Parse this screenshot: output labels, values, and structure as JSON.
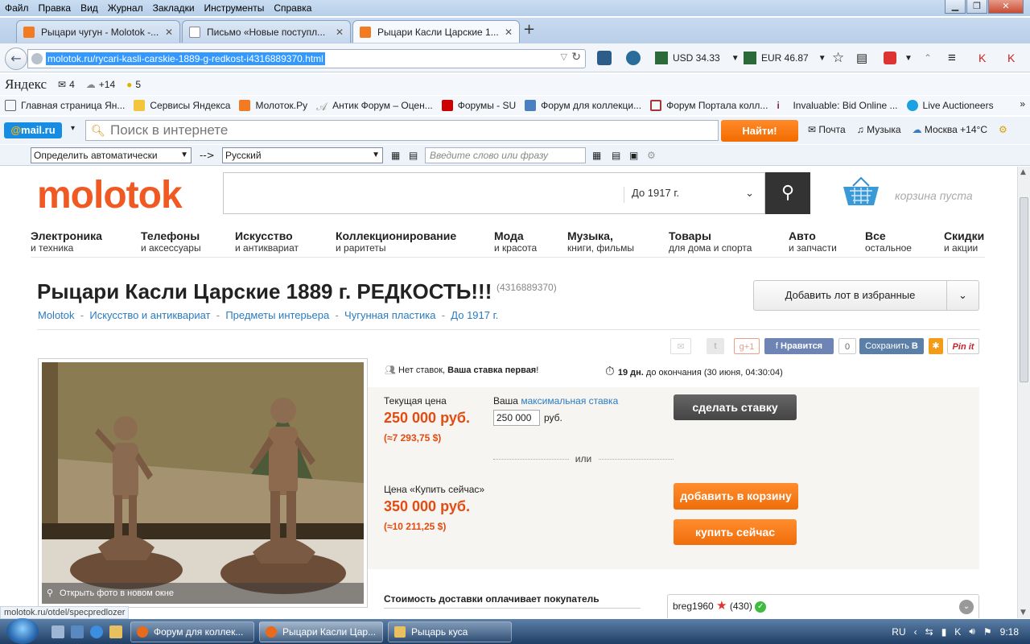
{
  "menu": [
    "Файл",
    "Правка",
    "Вид",
    "Журнал",
    "Закладки",
    "Инструменты",
    "Справка"
  ],
  "tabs": [
    {
      "label": "Рыцари чугун - Molotok -...",
      "icon": "molotok-favicon"
    },
    {
      "label": "Письмо «Новые поступл...",
      "icon": "mail-favicon"
    },
    {
      "label": "Рыцари Касли Царские 1...",
      "icon": "molotok-favicon",
      "active": true
    }
  ],
  "url": "molotok.ru/rycari-kasli-carskie-1889-g-redkost-i4316889370.html",
  "currency": {
    "usd": "USD 34.33",
    "eur": "EUR 46.87"
  },
  "yandex": {
    "logo": "Яндекс",
    "mail_count": "4",
    "weather": "+14",
    "lenta": "5"
  },
  "bookmarks": [
    "Главная страница Ян...",
    "Сервисы Яндекса",
    "Молоток.Ру",
    "Антик Форум – Оцен...",
    "Форумы - SU",
    "Форум для коллекци...",
    "Форум Портала колл...",
    "Invaluable: Bid Online ...",
    "Live Auctioneers"
  ],
  "mailru": {
    "logo_prefix": "@",
    "logo_text": "mail.ru",
    "search_placeholder": "Поиск в интернете",
    "find_button": "Найти!",
    "mail": "Почта",
    "music": "Музыка",
    "weather": "Москва +14°C"
  },
  "translator": {
    "from": "Определить автоматически",
    "arrow": "-->",
    "to": "Русский",
    "placeholder": "Введите слово или фразу"
  },
  "site": {
    "logo": "molotok",
    "search_category": "До 1917 г.",
    "cart": "корзина пуста",
    "nav": [
      {
        "title": "Электроника",
        "sub": "и техника"
      },
      {
        "title": "Телефоны",
        "sub": "и аксессуары"
      },
      {
        "title": "Искусство",
        "sub": "и антиквариат"
      },
      {
        "title": "Коллекционирование",
        "sub": "и раритеты"
      },
      {
        "title": "Мода",
        "sub": "и красота"
      },
      {
        "title": "Музыка,",
        "sub": "книги, фильмы"
      },
      {
        "title": "Товары",
        "sub": "для дома и спорта"
      },
      {
        "title": "Авто",
        "sub": "и запчасти"
      },
      {
        "title": "Все",
        "sub": "остальное"
      },
      {
        "title": "Скидки",
        "sub": "и акции"
      }
    ]
  },
  "lot": {
    "title": "Рыцари Касли Царские 1889 г. РЕДКОСТЬ!!!",
    "id": "(4316889370)",
    "fav_button": "Добавить лот в избранные",
    "breadcrumbs": [
      "Molotok",
      "Искусство и антиквариат",
      "Предметы интерьера",
      "Чугунная пластика",
      "До 1917 г."
    ],
    "breadcrumb_sep": "-",
    "social": {
      "gplus": "g+1",
      "like": "Нравится",
      "like_count": "0",
      "save": "Сохранить",
      "pinit": "Pin it"
    },
    "bids": {
      "no_bids": "Нет ставок,",
      "first": "Ваша ставка первая",
      "excl": "!"
    },
    "time": {
      "days": "19 дн.",
      "rest": "до окончания (30 июня, 04:30:04)"
    },
    "current_label": "Текущая цена",
    "current_price": "250 000 руб.",
    "current_usd": "(≈7 293,75 $)",
    "max_label": "Ваша",
    "max_link": "максимальная ставка",
    "bid_value": "250 000",
    "rub": "руб.",
    "bid_button": "сделать ставку",
    "or": "или",
    "buy_label": "Цена «Купить сейчас»",
    "buy_price": "350 000 руб.",
    "buy_usd": "(≈10 211,25 $)",
    "cart_button": "добавить в корзину",
    "buy_button": "купить сейчас",
    "photo_open": "Открыть фото в новом окне",
    "shipping": "Стоимость доставки оплачивает покупатель",
    "seller": {
      "name": "breg1960",
      "rating": "(430)"
    }
  },
  "status_url": "molotok.ru/otdel/specpredlozer",
  "taskbar": {
    "tasks": [
      "Форум для коллек...",
      "Рыцари Касли Цар...",
      "Рыцарь куса"
    ],
    "lang": "RU",
    "time": "9:18"
  },
  "colors": {
    "molotok_orange": "#f05a22",
    "price_red": "#e24b12",
    "link_blue": "#2b7bc0",
    "button_orange": "#f06d0a"
  }
}
